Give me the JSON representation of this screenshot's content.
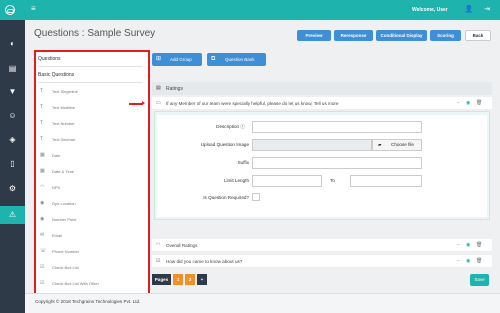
{
  "app": {
    "menu_icon": "hamburger-icon",
    "welcome": "Welcome, User"
  },
  "sidebar": {
    "items": [
      "dashboard-icon",
      "book-icon",
      "filter-icon",
      "users-icon",
      "layers-icon",
      "file-icon",
      "settings-icon",
      "warning-icon"
    ]
  },
  "header": {
    "title": "Questions : Sample Survey",
    "buttons": {
      "preview": "Preview",
      "reresponse": "Reresponse",
      "conditional": "Conditional Display",
      "scoring": "Scoring",
      "back": "Back"
    }
  },
  "toolbox": {
    "title": "Questions",
    "section": "Basic Questions",
    "items": [
      {
        "icon": "text-icon",
        "label": "Text Singleline"
      },
      {
        "icon": "text-icon",
        "label": "Text Multiline"
      },
      {
        "icon": "text-icon",
        "label": "Text Number"
      },
      {
        "icon": "text-icon",
        "label": "Text Decimal"
      },
      {
        "icon": "calendar-icon",
        "label": "Date"
      },
      {
        "icon": "calendar-icon",
        "label": "Date & Time"
      },
      {
        "icon": "gauge-icon",
        "label": "NPS"
      },
      {
        "icon": "location-icon",
        "label": "Gps Location"
      },
      {
        "icon": "location-icon",
        "label": "Number Point"
      },
      {
        "icon": "mail-icon",
        "label": "Email"
      },
      {
        "icon": "phone-icon",
        "label": "Phone Number"
      },
      {
        "icon": "checkbox-icon",
        "label": "Check Box List"
      },
      {
        "icon": "checkbox-icon",
        "label": "Check Box List With Other"
      }
    ]
  },
  "actions": {
    "add_group": "Add Group",
    "question_bank": "Question Bank"
  },
  "groups": [
    {
      "title": "Ratings"
    }
  ],
  "questions": [
    {
      "text": "If any Member of our team were specially helpful, please do let us know, Tell us more"
    },
    {
      "text": "Overall Ratings"
    },
    {
      "text": "How did you came to know about us?"
    }
  ],
  "editor": {
    "description_label": "Description",
    "upload_label": "Upload Question Image",
    "choose_file": "Choose file",
    "suffix_label": "Suffix",
    "limit_label": "Limit Length",
    "to_label": "To",
    "required_label": "Is Question Required?"
  },
  "pager": {
    "label": "Pages",
    "pages": [
      "1",
      "2"
    ],
    "add": "+"
  },
  "save": "Save",
  "footer": "Copyright © 2018 Techgrains Technologies Pvt. Ltd.",
  "colors": {
    "accent": "#1fb3ad",
    "primary": "#3f8fd6",
    "sidebar": "#2e3a48",
    "page_active": "#f0902a",
    "highlight": "#e02020"
  }
}
